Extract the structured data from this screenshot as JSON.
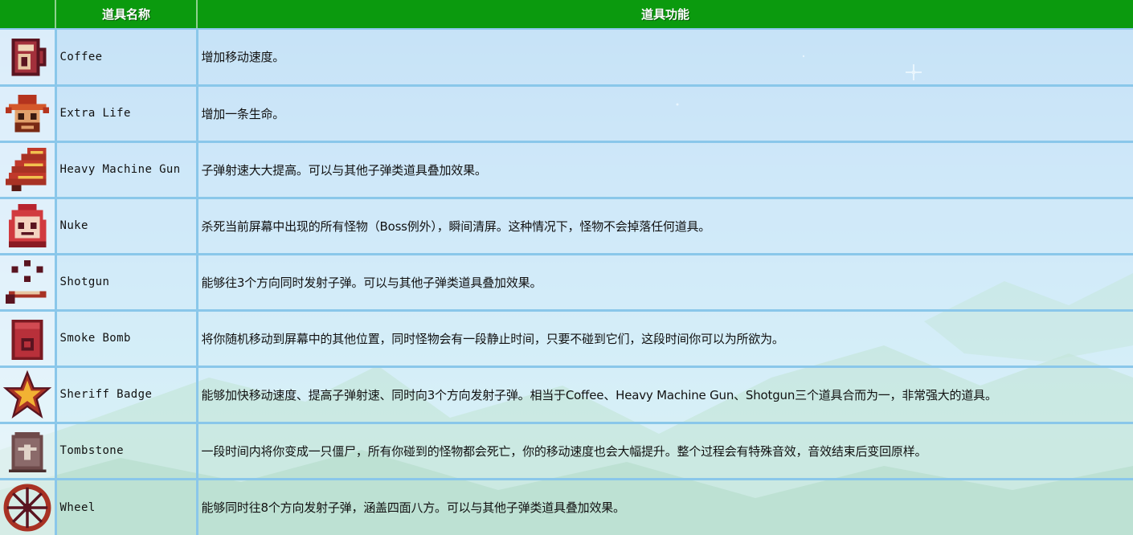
{
  "header": {
    "name_col": "道具名称",
    "func_col": "道具功能"
  },
  "items": [
    {
      "icon": "coffee-icon",
      "name": "Coffee",
      "desc": "增加移动速度。"
    },
    {
      "icon": "extra-life-icon",
      "name": "Extra Life",
      "desc": "增加一条生命。"
    },
    {
      "icon": "heavy-machine-gun-icon",
      "name": "Heavy Machine Gun",
      "desc": "子弹射速大大提高。可以与其他子弹类道具叠加效果。"
    },
    {
      "icon": "nuke-icon",
      "name": "Nuke",
      "desc": "杀死当前屏幕中出现的所有怪物（Boss例外），瞬间清屏。这种情况下，怪物不会掉落任何道具。"
    },
    {
      "icon": "shotgun-icon",
      "name": "Shotgun",
      "desc": "能够往3个方向同时发射子弹。可以与其他子弹类道具叠加效果。"
    },
    {
      "icon": "smoke-bomb-icon",
      "name": "Smoke Bomb",
      "desc": "将你随机移动到屏幕中的其他位置，同时怪物会有一段静止时间，只要不碰到它们，这段时间你可以为所欲为。"
    },
    {
      "icon": "sheriff-badge-icon",
      "name": "Sheriff Badge",
      "desc": "能够加快移动速度、提高子弹射速、同时向3个方向发射子弹。相当于Coffee、Heavy Machine Gun、Shotgun三个道具合而为一，非常强大的道具。"
    },
    {
      "icon": "tombstone-icon",
      "name": "Tombstone",
      "desc": "一段时间内将你变成一只僵尸，所有你碰到的怪物都会死亡，你的移动速度也会大幅提升。整个过程会有特殊音效，音效结束后变回原样。"
    },
    {
      "icon": "wheel-icon",
      "name": "Wheel",
      "desc": "能够同时往8个方向发射子弹，涵盖四面八方。可以与其他子弹类道具叠加效果。"
    }
  ]
}
